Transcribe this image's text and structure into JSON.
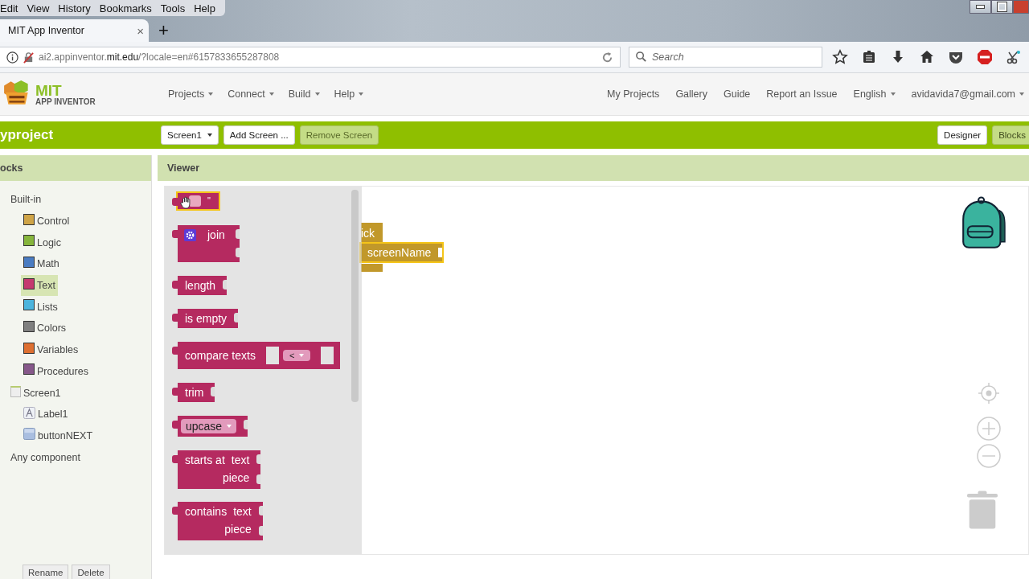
{
  "browser": {
    "menu": [
      "Edit",
      "View",
      "History",
      "Bookmarks",
      "Tools",
      "Help"
    ],
    "tab": {
      "title": "MIT App Inventor",
      "close": "×"
    },
    "new_tab": "+",
    "url": {
      "subdomain": "ai2.appinventor.",
      "domain": "mit.edu",
      "path": "/?locale=en#6157833655287808"
    },
    "search": {
      "placeholder": "Search"
    }
  },
  "app": {
    "logo": {
      "title": "MIT",
      "subtitle": "APP INVENTOR"
    },
    "menus": [
      "Projects",
      "Connect",
      "Build",
      "Help"
    ],
    "links": [
      "My Projects",
      "Gallery",
      "Guide",
      "Report an Issue"
    ],
    "language": "English",
    "account": "avidavida7@gmail.com"
  },
  "project_bar": {
    "title": "yproject",
    "screen": "Screen1",
    "buttons": [
      "Add Screen ...",
      "Remove Screen"
    ],
    "views": [
      {
        "label": "Designer",
        "selected": false
      },
      {
        "label": "Blocks",
        "selected": true
      }
    ]
  },
  "blocks_panel": {
    "title": "ocks",
    "tree": [
      {
        "label": "Built-in",
        "kind": "group",
        "selected": false,
        "children": [
          {
            "label": "Control",
            "kind": "category",
            "color": "#cfa447",
            "selected": false
          },
          {
            "label": "Logic",
            "kind": "category",
            "color": "#86b53c",
            "selected": false
          },
          {
            "label": "Math",
            "kind": "category",
            "color": "#4a7cc2",
            "selected": false
          },
          {
            "label": "Text",
            "kind": "category",
            "color": "#c43a6e",
            "selected": true
          },
          {
            "label": "Lists",
            "kind": "category",
            "color": "#4db4dd",
            "selected": false
          },
          {
            "label": "Colors",
            "kind": "category",
            "color": "#7f7f7f",
            "selected": false
          },
          {
            "label": "Variables",
            "kind": "category",
            "color": "#dd6f31",
            "selected": false
          },
          {
            "label": "Procedures",
            "kind": "category",
            "color": "#86588a",
            "selected": false
          }
        ]
      },
      {
        "label": "Screen1",
        "kind": "screen",
        "selected": false,
        "children": [
          {
            "label": "Label1",
            "kind": "label",
            "selected": false
          },
          {
            "label": "buttonNEXT",
            "kind": "button",
            "selected": false
          }
        ]
      },
      {
        "label": "Any component",
        "kind": "group",
        "selected": false
      }
    ],
    "buttons": [
      "Rename",
      "Delete"
    ]
  },
  "viewer": {
    "title": "Viewer",
    "flyout": [
      {
        "kind": "string",
        "quote": "\"",
        "selected": true
      },
      {
        "kind": "join",
        "labels": [
          "join"
        ],
        "selected": false
      },
      {
        "kind": "simple",
        "labels": [
          "length"
        ],
        "selected": false
      },
      {
        "kind": "simple",
        "labels": [
          "is empty"
        ],
        "selected": false
      },
      {
        "kind": "compare",
        "labels": [
          "compare texts"
        ],
        "op": "<",
        "selected": false
      },
      {
        "kind": "simple",
        "labels": [
          "trim"
        ],
        "selected": false
      },
      {
        "kind": "dropdown",
        "op": "upcase",
        "selected": false
      },
      {
        "kind": "two_arg",
        "labels": [
          "starts at",
          "text",
          "piece"
        ],
        "selected": false
      },
      {
        "kind": "two_arg",
        "labels": [
          "contains",
          "text",
          "piece"
        ],
        "selected": false
      }
    ],
    "workspace_blocks": [
      {
        "kind": "event",
        "text": "ick",
        "selected": false
      },
      {
        "kind": "argument",
        "text": "screenName",
        "selected": true
      }
    ]
  }
}
